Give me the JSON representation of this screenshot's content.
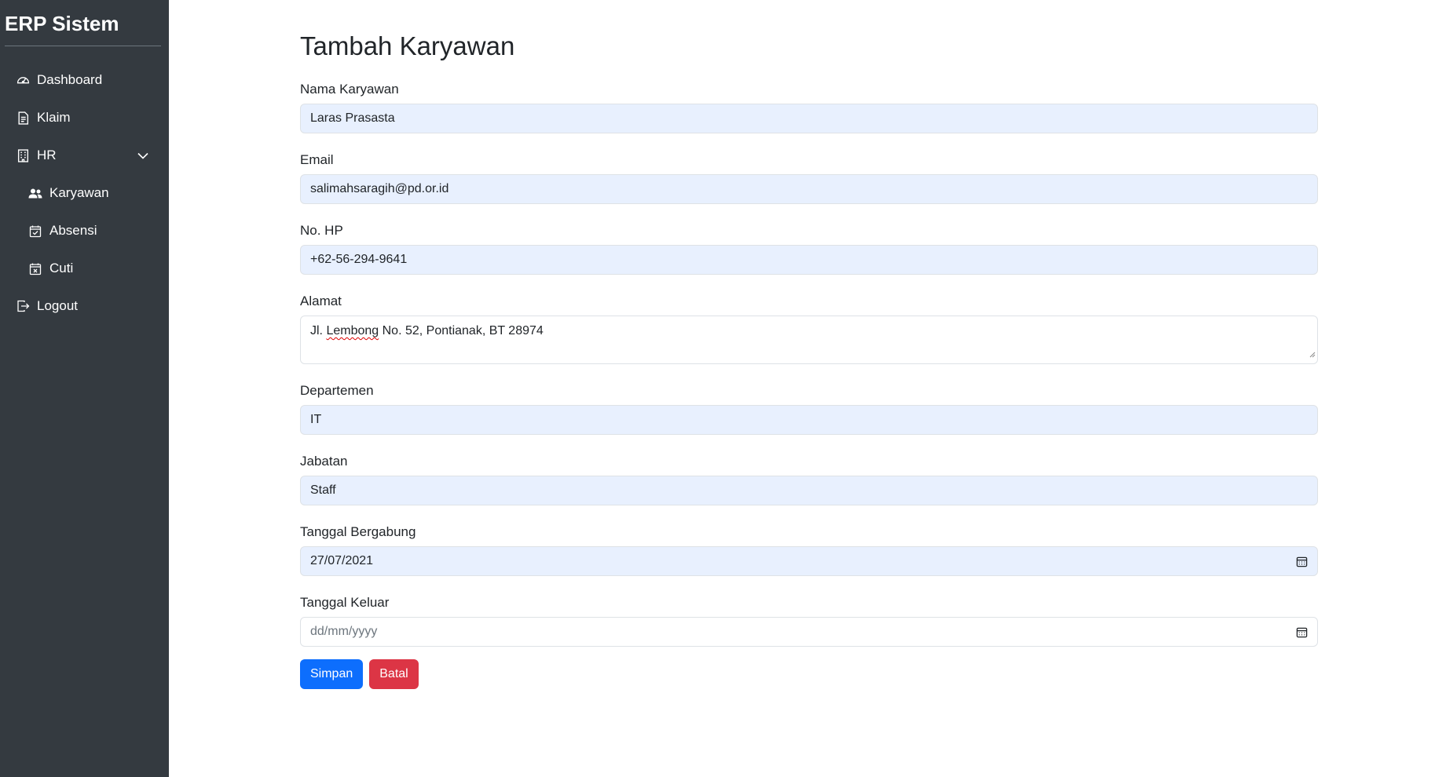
{
  "sidebar": {
    "brand": "ERP Sistem",
    "items": [
      {
        "label": "Dashboard",
        "icon": "speedometer-icon"
      },
      {
        "label": "Klaim",
        "icon": "document-icon"
      },
      {
        "label": "HR",
        "icon": "building-icon"
      },
      {
        "label": "Karyawan",
        "icon": "people-icon"
      },
      {
        "label": "Absensi",
        "icon": "calendar-check-icon"
      },
      {
        "label": "Cuti",
        "icon": "calendar-x-icon"
      },
      {
        "label": "Logout",
        "icon": "logout-icon"
      }
    ]
  },
  "page": {
    "title": "Tambah Karyawan"
  },
  "form": {
    "nama": {
      "label": "Nama Karyawan",
      "value": "Laras Prasasta"
    },
    "email": {
      "label": "Email",
      "value": "salimahsaragih@pd.or.id"
    },
    "hp": {
      "label": "No. HP",
      "value": "+62-56-294-9641"
    },
    "alamat": {
      "label": "Alamat",
      "value_prefix": "Jl. ",
      "value_misspelled": "Lembong",
      "value_suffix": " No. 52, Pontianak, BT 28974"
    },
    "departemen": {
      "label": "Departemen",
      "value": "IT"
    },
    "jabatan": {
      "label": "Jabatan",
      "value": "Staff"
    },
    "tgl_gabung": {
      "label": "Tanggal Bergabung",
      "value": "27/07/2021"
    },
    "tgl_keluar": {
      "label": "Tanggal Keluar",
      "placeholder": "dd/mm/yyyy"
    }
  },
  "buttons": {
    "save": "Simpan",
    "cancel": "Batal"
  },
  "colors": {
    "sidebar": "#343a40",
    "primary": "#0d6efd",
    "danger": "#dc3545",
    "autofill": "#e8f0fe"
  }
}
